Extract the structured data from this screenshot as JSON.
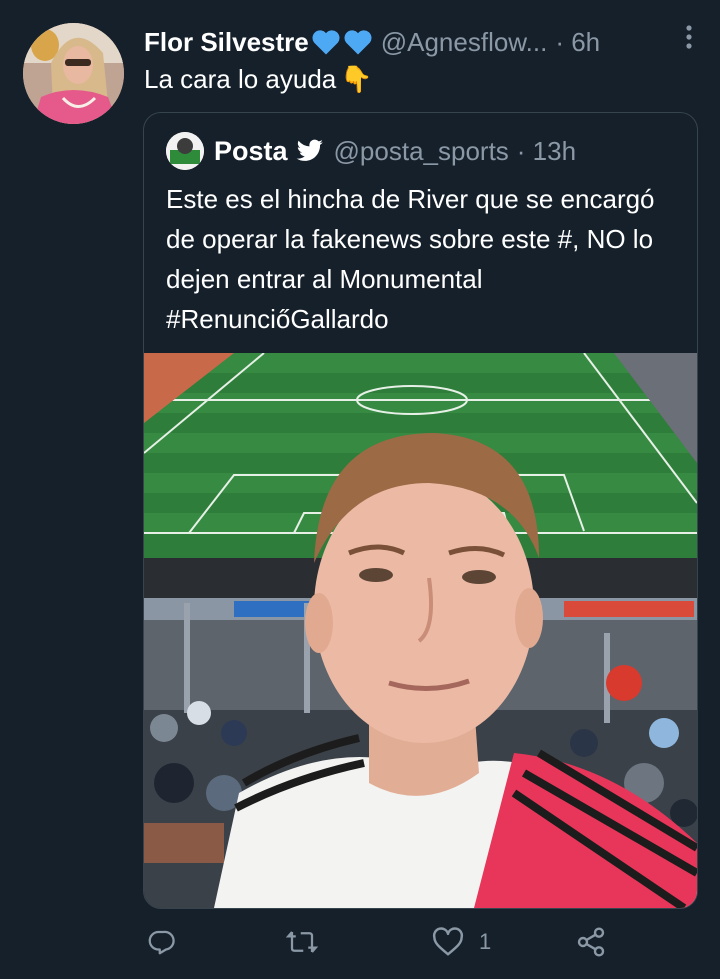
{
  "tweet": {
    "author_name": "Flor Silvestre",
    "handle": "@Agnesflow...",
    "time": "· 6h",
    "text": "La cara lo ayuda",
    "emoji": "👇",
    "more_icon": "more-vertical-icon"
  },
  "quoted": {
    "author_name": "Posta",
    "handle": "@posta_sports",
    "time": "· 13h",
    "text": "Este es el hincha de River que se encargó de operar la fakenews sobre este #, NO lo dejen entrar al Monumental #RenunciőGallardo"
  },
  "actions": {
    "reply_icon": "reply-icon",
    "retweet_icon": "retweet-icon",
    "like_icon": "heart-icon",
    "like_count": "1",
    "share_icon": "share-icon"
  },
  "colors": {
    "background": "#15202b",
    "secondary_text": "#8b98a5",
    "border": "#38444d",
    "accent": "#1d9bf0",
    "heart_blue": "#4ea9f5"
  }
}
